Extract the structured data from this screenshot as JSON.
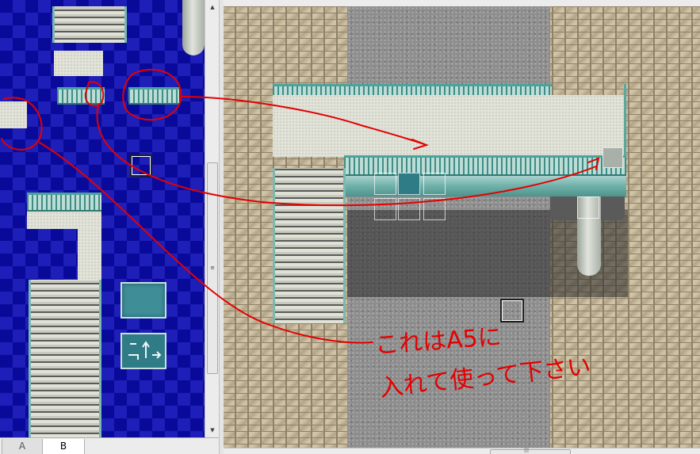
{
  "palette": {
    "tabs": [
      {
        "label": "A",
        "active": false
      },
      {
        "label": "B",
        "active": true
      }
    ],
    "background_colors": [
      "#0a0a9a",
      "#1e1eb8"
    ]
  },
  "map": {
    "scroll_grip": "|||"
  },
  "annotation": {
    "line1": "これはA5に",
    "line2": "入れて使って下さい",
    "color": "#e40000"
  },
  "icons": {
    "scroll_up": "▲",
    "scroll_down": "▼",
    "grip": "≡"
  }
}
